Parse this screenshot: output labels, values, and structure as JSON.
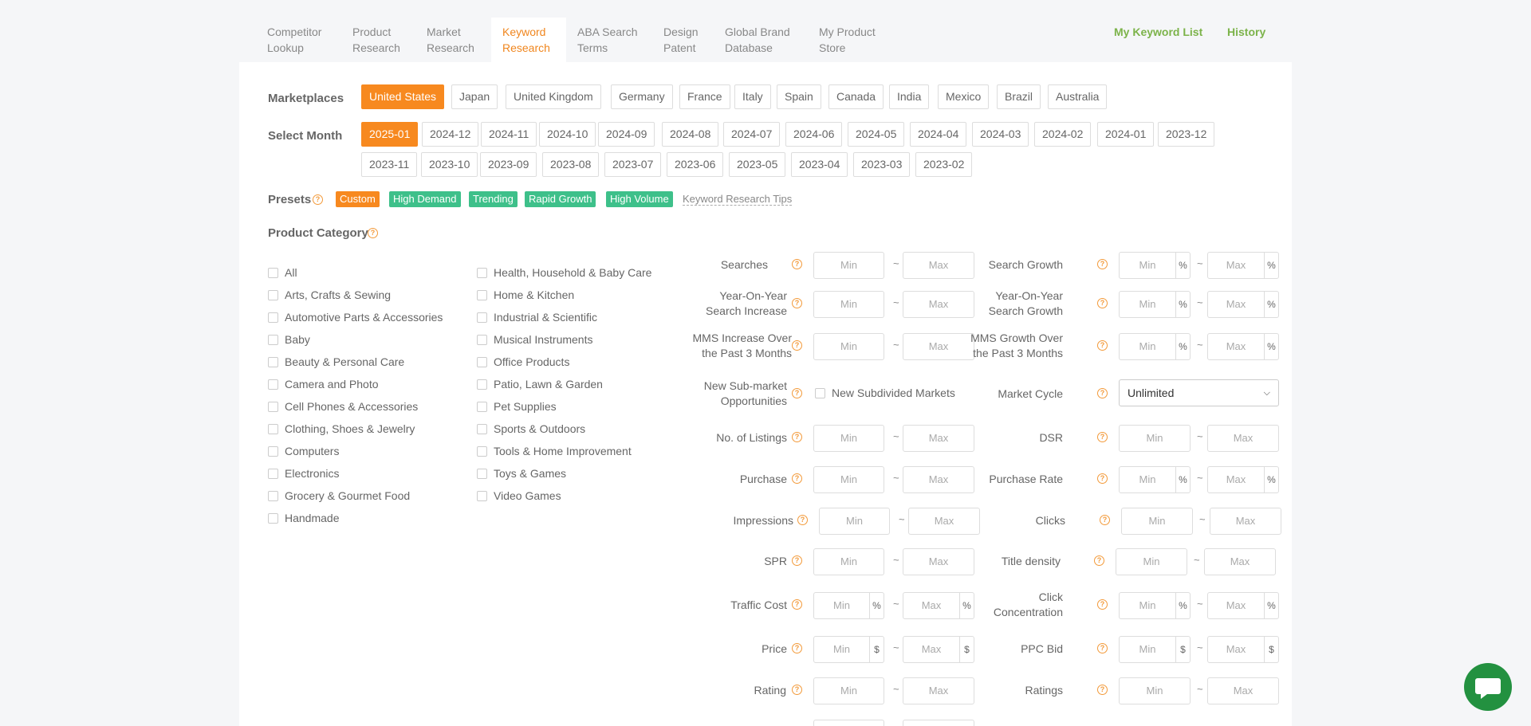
{
  "nav": {
    "tabs": [
      {
        "label": "Competitor\nLookup"
      },
      {
        "label": "Product\nResearch"
      },
      {
        "label": "Market\nResearch"
      },
      {
        "label": "Keyword\nResearch"
      },
      {
        "label": "ABA Search\nTerms"
      },
      {
        "label": "Design\nPatent"
      },
      {
        "label": "Global Brand\nDatabase"
      },
      {
        "label": "My Product\nStore"
      }
    ],
    "my_keyword_list": "My Keyword List",
    "history": "History"
  },
  "marketplaces": {
    "label": "Marketplaces",
    "items": [
      "United States",
      "Japan",
      "United Kingdom",
      "Germany",
      "France",
      "Italy",
      "Spain",
      "Canada",
      "India",
      "Mexico",
      "Brazil",
      "Australia"
    ],
    "selected": "United States"
  },
  "month": {
    "label": "Select Month",
    "row1": [
      "2025-01",
      "2024-12",
      "2024-11",
      "2024-10",
      "2024-09",
      "2024-08",
      "2024-07",
      "2024-06",
      "2024-05",
      "2024-04",
      "2024-03",
      "2024-02",
      "2024-01",
      "2023-12"
    ],
    "row2": [
      "2023-11",
      "2023-10",
      "2023-09",
      "2023-08",
      "2023-07",
      "2023-06",
      "2023-05",
      "2023-04",
      "2023-03",
      "2023-02"
    ],
    "selected": "2025-01"
  },
  "presets": {
    "label": "Presets",
    "items": [
      "Custom",
      "High Demand",
      "Trending",
      "Rapid Growth",
      "High Volume"
    ],
    "tips": "Keyword Research Tips"
  },
  "category": {
    "label": "Product Category",
    "col1": [
      "All",
      "Arts, Crafts & Sewing",
      "Automotive Parts & Accessories",
      "Baby",
      "Beauty & Personal Care",
      "Camera and Photo",
      "Cell Phones & Accessories",
      "Clothing, Shoes & Jewelry",
      "Computers",
      "Electronics",
      "Grocery & Gourmet Food",
      "Handmade"
    ],
    "col2": [
      "Health, Household & Baby Care",
      "Home & Kitchen",
      "Industrial & Scientific",
      "Musical Instruments",
      "Office Products",
      "Patio, Lawn & Garden",
      "Pet Supplies",
      "Sports & Outdoors",
      "Tools & Home Improvement",
      "Toys & Games",
      "Video Games"
    ]
  },
  "placeholders": {
    "min": "Min",
    "max": "Max"
  },
  "symbols": {
    "tilde": "~",
    "percent": "%",
    "dollar": "$",
    "question": "?"
  },
  "filters": {
    "searches": "Searches",
    "search_growth": "Search Growth",
    "yoy_search_increase": "Year-On-Year\nSearch Increase",
    "yoy_search_growth": "Year-On-Year\nSearch Growth",
    "mms_increase": "MMS Increase Over\nthe Past 3 Months",
    "mms_growth": "MMS Growth Over\nthe Past 3 Months",
    "new_submarket": "New Sub-market\nOpportunities",
    "new_subdivided": "New Subdivided Markets",
    "market_cycle": "Market Cycle",
    "market_cycle_value": "Unlimited",
    "listings": "No. of Listings",
    "dsr": "DSR",
    "purchase": "Purchase",
    "purchase_rate": "Purchase Rate",
    "impressions": "Impressions",
    "clicks": "Clicks",
    "spr": "SPR",
    "title_density": "Title density",
    "traffic_cost": "Traffic Cost",
    "click_concentration": "Click\nConcentration",
    "price": "Price",
    "ppc_bid": "PPC Bid",
    "rating": "Rating",
    "ratings": "Ratings"
  },
  "colors": {
    "accent": "#f7891f",
    "preset_green": "#3ec08a",
    "link_green": "#7cb34a",
    "chat_green": "#239140"
  },
  "icons": {
    "help": "question-circle-icon",
    "chat": "chat-bubble-icon",
    "select": "chevron-down-icon"
  }
}
